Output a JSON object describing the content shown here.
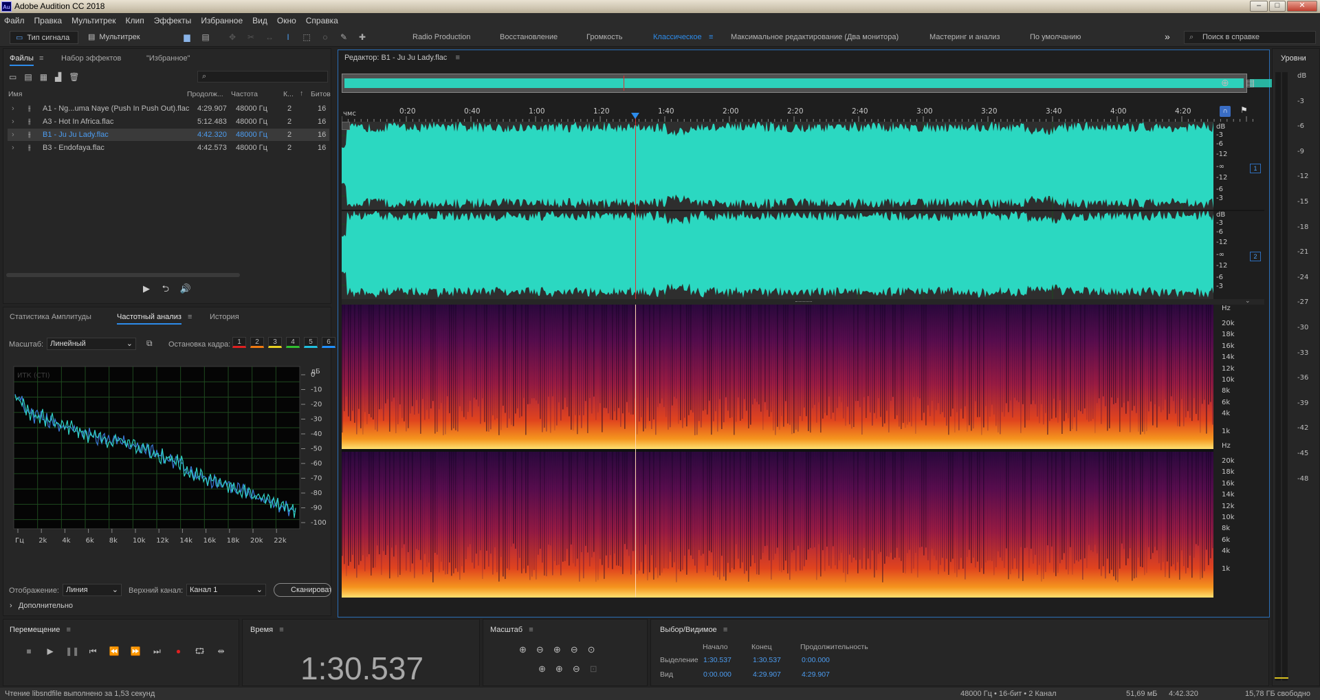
{
  "window": {
    "title": "Adobe Audition CC 2018",
    "app_icon": "Au"
  },
  "menu": [
    "Файл",
    "Правка",
    "Мультитрек",
    "Клип",
    "Эффекты",
    "Избранное",
    "Вид",
    "Окно",
    "Справка"
  ],
  "toolbar": {
    "waveform_label": "Тип сигнала",
    "multitrack_label": "Мультитрек",
    "workspaces": [
      "Radio Production",
      "Восстановление",
      "Громкость",
      "Классическое",
      "Максимальное редактирование (Два монитора)",
      "Мастеринг и анализ",
      "По умолчанию"
    ],
    "active_workspace": "Классическое",
    "more": "»",
    "help_placeholder": "Поиск в справке"
  },
  "files_panel": {
    "tabs": [
      "Файлы",
      "Набор эффектов",
      "\"Избранное\""
    ],
    "search_icon": "⌕",
    "columns": [
      "Имя",
      "Продолж...",
      "Частота",
      "К...",
      "Битов"
    ],
    "files": [
      {
        "name": "A1 - Ng...uma Naye (Push In Push Out).flac",
        "duration": "4:29.907",
        "rate": "48000 Гц",
        "ch": "2",
        "bits": "16",
        "selected": false
      },
      {
        "name": "A3 - Hot In Africa.flac",
        "duration": "5:12.483",
        "rate": "48000 Гц",
        "ch": "2",
        "bits": "16",
        "selected": false
      },
      {
        "name": "B1 - Ju Ju Lady.flac",
        "duration": "4:42.320",
        "rate": "48000 Гц",
        "ch": "2",
        "bits": "16",
        "selected": true
      },
      {
        "name": "B3 - Endofaya.flac",
        "duration": "4:42.573",
        "rate": "48000 Гц",
        "ch": "2",
        "bits": "16",
        "selected": false
      }
    ]
  },
  "analysis_panel": {
    "tabs": [
      "Статистика Амплитуды",
      "Частотный анализ",
      "История"
    ],
    "scale_label": "Масштаб:",
    "scale_value": "Линейный",
    "freeze_label": "Остановка кадра:",
    "freeze_buttons": [
      "1",
      "2",
      "3",
      "4",
      "5",
      "6"
    ],
    "freeze_colors": [
      "#e02020",
      "#f07a10",
      "#e8d020",
      "#30c030",
      "#20c0e0",
      "#2090ff"
    ],
    "graph_label": "ИТК (СТI)",
    "db_unit": "дБ",
    "db_ticks": [
      "0",
      "-10",
      "-20",
      "-30",
      "-40",
      "-50",
      "-60",
      "-70",
      "-80",
      "-90",
      "-100"
    ],
    "freq_ticks": [
      "Гц",
      "2k",
      "4k",
      "6k",
      "8k",
      "10k",
      "12k",
      "14k",
      "16k",
      "18k",
      "20k",
      "22k"
    ],
    "display_label": "Отображение:",
    "display_value": "Линия",
    "channel_label": "Верхний канал:",
    "channel_value": "Канал 1",
    "scan_label": "Сканировать",
    "advanced_label": "Дополнительно"
  },
  "editor": {
    "title": "Редактор: B1 - Ju Ju Lady.flac",
    "ruler_unit": "чмс",
    "ruler_ticks": [
      "0:20",
      "0:40",
      "1:00",
      "1:20",
      "1:40",
      "2:00",
      "2:20",
      "2:40",
      "3:00",
      "3:20",
      "3:40",
      "4:00",
      "4:20"
    ],
    "db_scale": [
      "dB",
      "-3",
      "-6",
      "-12",
      "-∞",
      "-12",
      "-6",
      "-3"
    ],
    "channel_numbers": [
      "1",
      "2"
    ],
    "hz_scale": [
      "Hz",
      "20k",
      "18k",
      "16k",
      "14k",
      "12k",
      "10k",
      "8k",
      "6k",
      "4k",
      "1k"
    ],
    "wave_color": "#2bd8c1",
    "playhead_color": "#e03030"
  },
  "levels_panel": {
    "title": "Уровни",
    "ticks": [
      "dB",
      "-3",
      "-6",
      "-9",
      "-12",
      "-15",
      "-18",
      "-21",
      "-24",
      "-27",
      "-30",
      "-33",
      "-36",
      "-39",
      "-42",
      "-45",
      "-48"
    ]
  },
  "transport": {
    "title": "Перемещение",
    "buttons": [
      "stop",
      "play",
      "pause",
      "to-start",
      "rewind",
      "fast-forward",
      "to-end",
      "record",
      "loop",
      "skip"
    ]
  },
  "time": {
    "title": "Время",
    "value": "1:30.537"
  },
  "zoom": {
    "title": "Масштаб"
  },
  "selection": {
    "title": "Выбор/Видимое",
    "headers": [
      "Начало",
      "Конец",
      "Продолжительность"
    ],
    "rows": [
      {
        "label": "Выделение",
        "start": "1:30.537",
        "end": "1:30.537",
        "duration": "0:00.000"
      },
      {
        "label": "Вид",
        "start": "0:00.000",
        "end": "4:29.907",
        "duration": "4:29.907"
      }
    ]
  },
  "status": {
    "left": "Чтение libsndfile выполнено за 1,53 секунд",
    "format": "48000 Гц • 16-бит • 2 Канал",
    "size": "51,69 мБ",
    "duration": "4:42.320",
    "free": "15,78 ГБ свободно"
  }
}
